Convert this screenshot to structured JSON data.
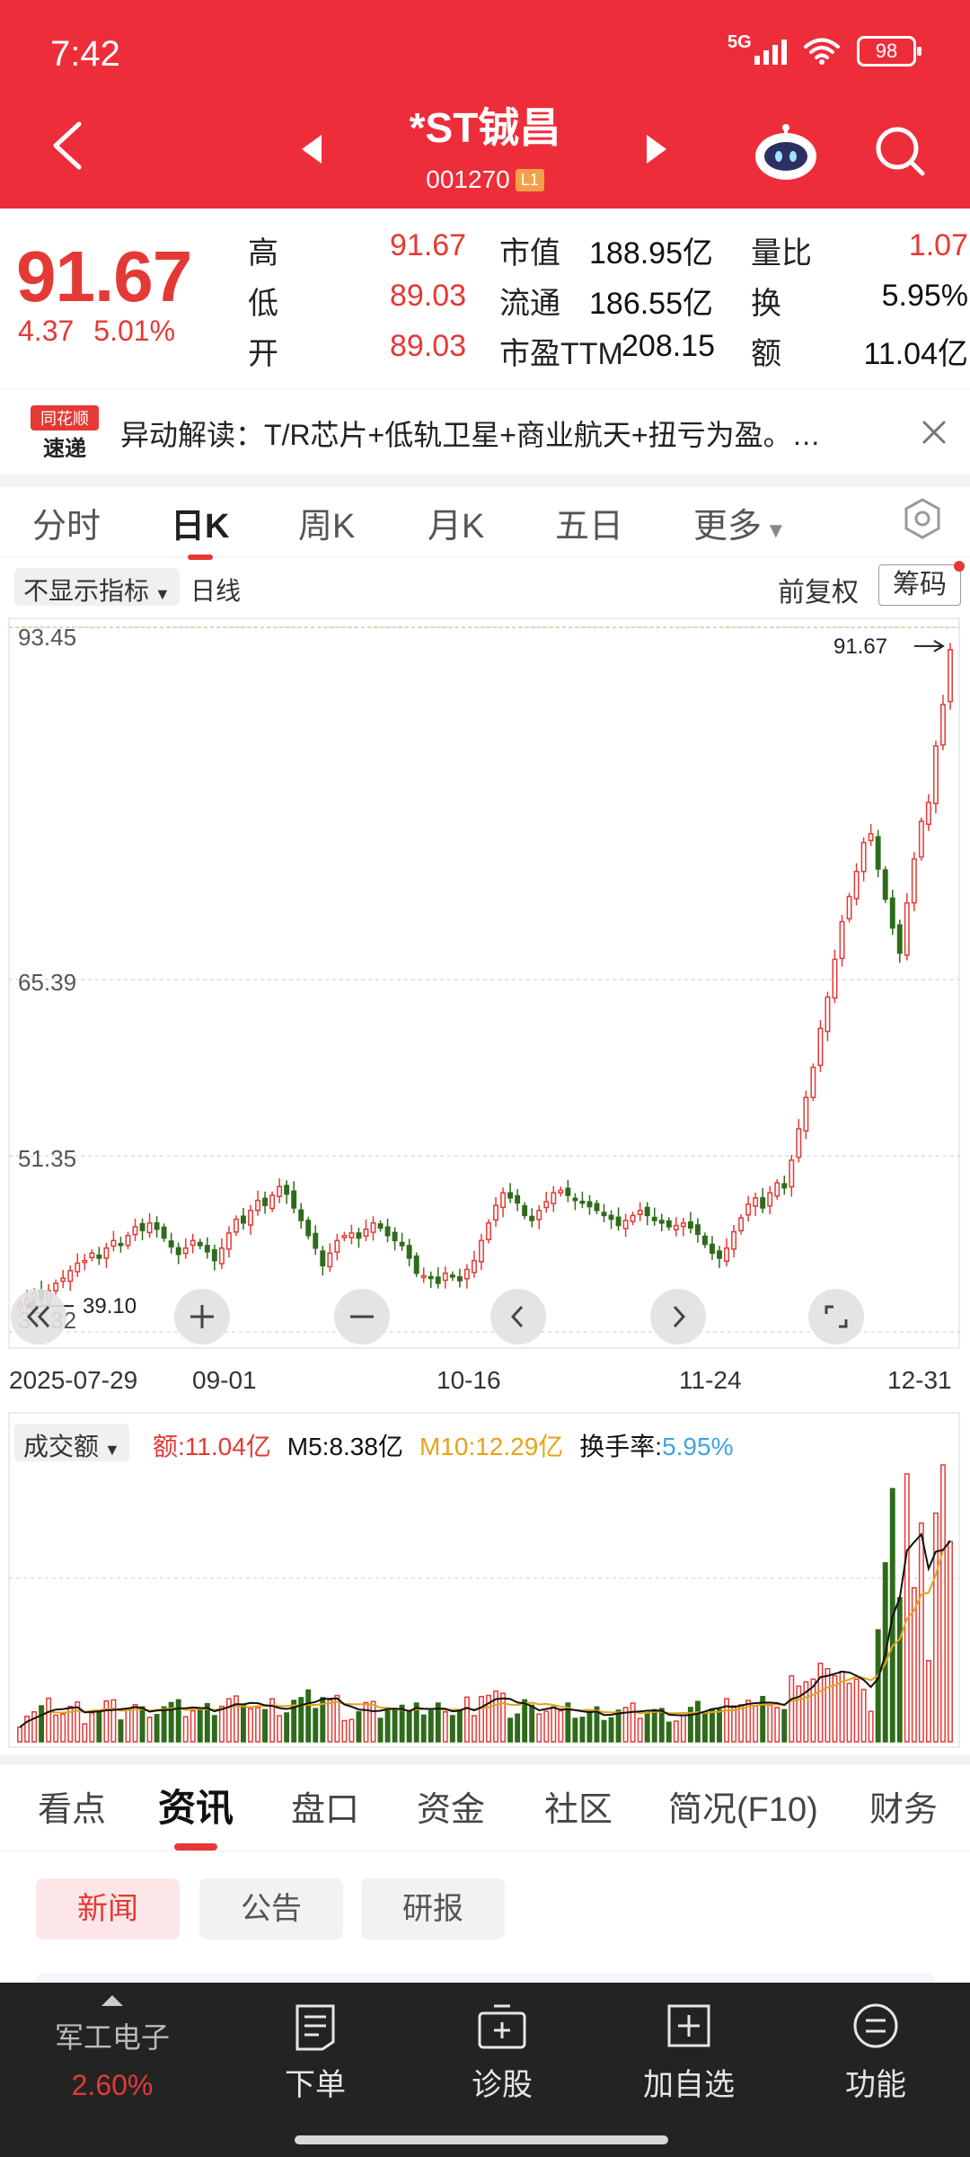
{
  "status_bar": {
    "time": "7:42",
    "network": "5G",
    "battery": "98"
  },
  "header": {
    "title": "*ST铖昌",
    "code": "001270",
    "level": "L1"
  },
  "quote": {
    "price": "91.67",
    "change": "4.37",
    "change_pct": "5.01%",
    "stats": [
      {
        "label": "高",
        "value": "91.67"
      },
      {
        "label": "低",
        "value": "89.03"
      },
      {
        "label": "开",
        "value": "89.03"
      },
      {
        "label": "市值",
        "value": "188.95亿"
      },
      {
        "label": "流通",
        "value": "186.55亿"
      },
      {
        "label": "市盈TTM",
        "value": "208.15"
      },
      {
        "label": "量比",
        "value": "1.07"
      },
      {
        "label": "换",
        "value": "5.95%"
      },
      {
        "label": "额",
        "value": "11.04亿"
      }
    ]
  },
  "news": {
    "text": "异动解读：T/R芯片+低轨卫星+商业航天+扭亏为盈。…",
    "logo_top": "同花顺",
    "logo_bottom": "速递"
  },
  "chart_tabs": [
    "分时",
    "日K",
    "周K",
    "月K",
    "五日",
    "更多"
  ],
  "chart_tabs_active": 1,
  "indicator": {
    "selector": "不显示指标",
    "line_type": "日线",
    "adjust": "前复权",
    "chips": "筹码"
  },
  "price_axis": {
    "top": "93.45",
    "mid": "65.39",
    "low": "51.35",
    "bottom": "37.32",
    "max_marker": "91.67",
    "min_marker": "39.10"
  },
  "date_axis": [
    "2025-07-29",
    "09-01",
    "10-16",
    "11-24",
    "12-31"
  ],
  "chart_data": {
    "type": "candlestick",
    "title": "",
    "dates_shown": [
      "2025-07-29",
      "09-01",
      "10-16",
      "11-24",
      "12-31"
    ],
    "ylim": [
      37.32,
      93.45
    ],
    "price_ticks": [
      93.45,
      65.39,
      51.35,
      37.32
    ],
    "high": 91.67,
    "low": 39.1,
    "close": [
      39.6,
      40.0,
      40.4,
      39.9,
      40.6,
      41.2,
      41.6,
      42.2,
      42.8,
      43.0,
      43.6,
      43.2,
      44.0,
      44.6,
      44.3,
      45.0,
      45.7,
      45.4,
      46.0,
      45.5,
      44.8,
      44.1,
      43.5,
      44.0,
      44.6,
      44.2,
      43.7,
      43.0,
      44.0,
      45.2,
      46.3,
      46.0,
      47.0,
      47.8,
      47.4,
      48.2,
      48.9,
      48.3,
      47.2,
      46.2,
      45.0,
      44.0,
      42.6,
      43.6,
      44.6,
      45.0,
      45.2,
      44.8,
      45.5,
      46.0,
      45.6,
      45.0,
      44.6,
      44.2,
      43.2,
      42.0,
      41.8,
      41.6,
      41.2,
      42.0,
      41.7,
      41.4,
      42.3,
      43.0,
      44.6,
      46.0,
      47.4,
      48.4,
      48.0,
      47.6,
      46.6,
      46.2,
      47.0,
      47.7,
      48.4,
      48.6,
      48.2,
      47.8,
      47.6,
      47.3,
      47.0,
      46.6,
      46.3,
      45.8,
      46.2,
      46.6,
      47.0,
      46.6,
      46.2,
      46.0,
      45.7,
      45.8,
      46.0,
      45.6,
      45.1,
      44.3,
      43.6,
      43.2,
      44.0,
      45.3,
      46.4,
      47.5,
      48.0,
      47.2,
      48.4,
      49.2,
      48.8,
      51.0,
      53.5,
      56.0,
      58.4,
      61.5,
      64.0,
      67.0,
      70.0,
      72.0,
      74.0,
      76.3,
      77.0,
      74.2,
      71.8,
      69.5,
      67.5,
      71.5,
      75.0,
      78.0,
      79.5,
      84.0,
      87.3,
      91.67
    ],
    "volume_labels": {
      "amount": "额:11.04亿",
      "m5": "M5:8.38亿",
      "m10": "M10:12.29亿",
      "turnover_label": "换手率:",
      "turnover": "5.95%"
    },
    "volume_selector": "成交额"
  },
  "colors": {
    "up": "#e53935",
    "down": "#2e6b1a",
    "m5": "#111111",
    "m10": "#e6a21a",
    "brand": "#ee2d3a",
    "turnover": "#3da4e0"
  },
  "bottom_tabs": [
    "看点",
    "资讯",
    "盘口",
    "资金",
    "社区",
    "简况(F10)",
    "财务"
  ],
  "bottom_tabs_active": 1,
  "news_pills": [
    "新闻",
    "公告",
    "研报"
  ],
  "news_pills_active": 0,
  "bottom_bar": {
    "sector_name": "军工电子",
    "sector_pct": "2.60%",
    "buttons": [
      {
        "label": "下单",
        "icon": "order-icon"
      },
      {
        "label": "诊股",
        "icon": "diagnose-icon"
      },
      {
        "label": "加自选",
        "icon": "add-watchlist-icon"
      },
      {
        "label": "功能",
        "icon": "menu-icon"
      }
    ]
  }
}
